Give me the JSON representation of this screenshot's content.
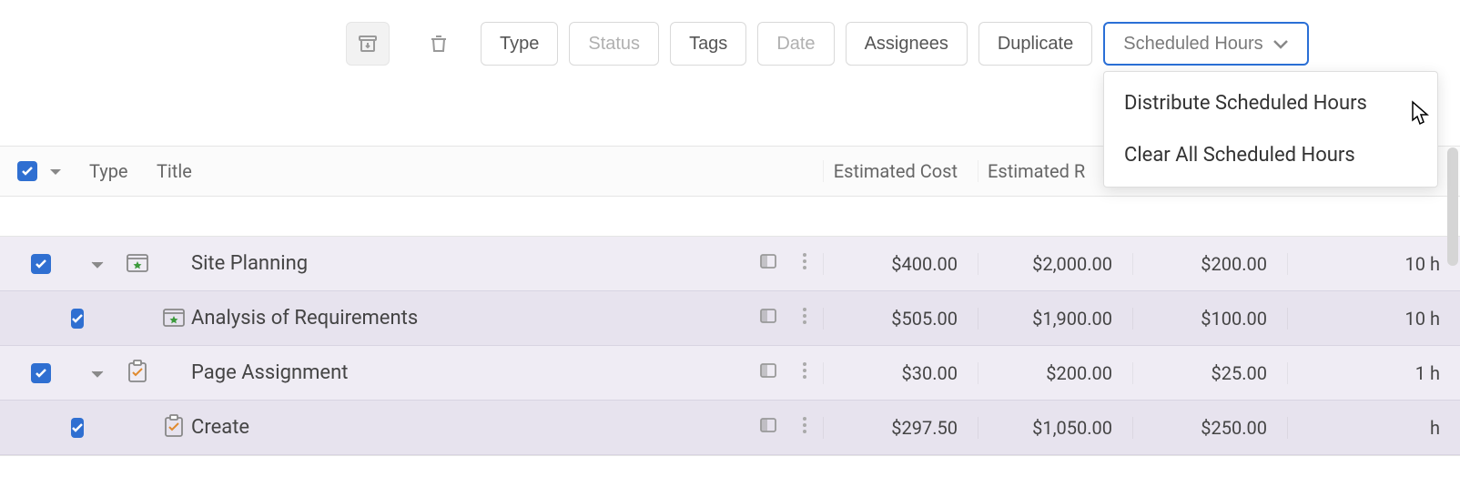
{
  "toolbar": {
    "type_label": "Type",
    "status_label": "Status",
    "tags_label": "Tags",
    "date_label": "Date",
    "assignees_label": "Assignees",
    "duplicate_label": "Duplicate",
    "scheduled_hours_label": "Scheduled Hours"
  },
  "dropdown": {
    "items": [
      {
        "label": "Distribute Scheduled Hours"
      },
      {
        "label": "Clear All Scheduled Hours"
      }
    ]
  },
  "columns": {
    "type": "Type",
    "title": "Title",
    "estimated_cost": "Estimated Cost",
    "estimated_remaining": "Estimated R"
  },
  "rows": [
    {
      "level": 0,
      "checked": true,
      "expandable": true,
      "type_icon": "box-star",
      "title": "Site Planning",
      "estimated_cost": "$400.00",
      "col2": "$2,000.00",
      "col3": "$200.00",
      "hours": "10 h"
    },
    {
      "level": 1,
      "checked": true,
      "expandable": false,
      "type_icon": "box-star",
      "title": "Analysis of Requirements",
      "estimated_cost": "$505.00",
      "col2": "$1,900.00",
      "col3": "$100.00",
      "hours": "10 h"
    },
    {
      "level": 0,
      "checked": true,
      "expandable": true,
      "type_icon": "clipboard-check",
      "title": "Page Assignment",
      "estimated_cost": "$30.00",
      "col2": "$200.00",
      "col3": "$25.00",
      "hours": "1 h"
    },
    {
      "level": 1,
      "checked": true,
      "expandable": false,
      "type_icon": "clipboard-check",
      "title": "Create",
      "estimated_cost": "$297.50",
      "col2": "$1,050.00",
      "col3": "$250.00",
      "hours": "h"
    }
  ]
}
